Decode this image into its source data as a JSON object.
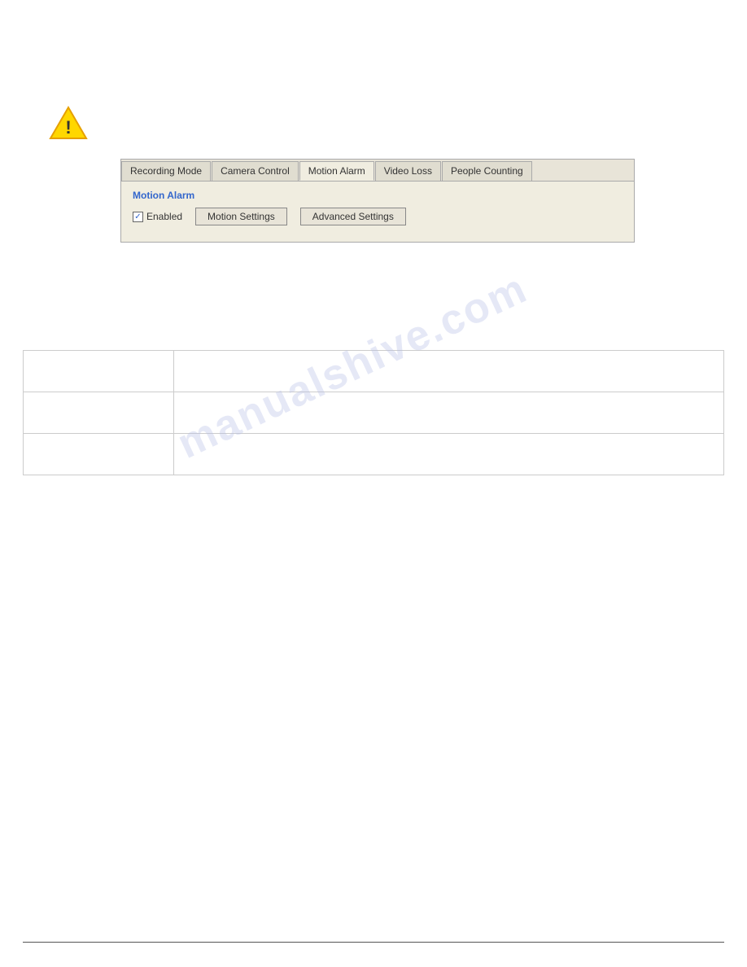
{
  "warning": {
    "icon": "warning-icon"
  },
  "tabs": [
    {
      "id": "recording-mode",
      "label": "Recording Mode",
      "active": false
    },
    {
      "id": "camera-control",
      "label": "Camera Control",
      "active": false
    },
    {
      "id": "motion-alarm",
      "label": "Motion Alarm",
      "active": true
    },
    {
      "id": "video-loss",
      "label": "Video Loss",
      "active": false
    },
    {
      "id": "people-counting",
      "label": "People Counting",
      "active": false
    }
  ],
  "panel": {
    "section_title": "Motion Alarm",
    "enabled_label": "Enabled",
    "checkbox_checked": true,
    "buttons": [
      {
        "id": "motion-settings",
        "label": "Motion Settings"
      },
      {
        "id": "advanced-settings",
        "label": "Advanced Settings"
      }
    ]
  },
  "table": {
    "rows": [
      {
        "left": "",
        "right": ""
      },
      {
        "left": "",
        "right": ""
      },
      {
        "left": "",
        "right": ""
      }
    ]
  },
  "watermark": {
    "text": "manualshive.com"
  }
}
